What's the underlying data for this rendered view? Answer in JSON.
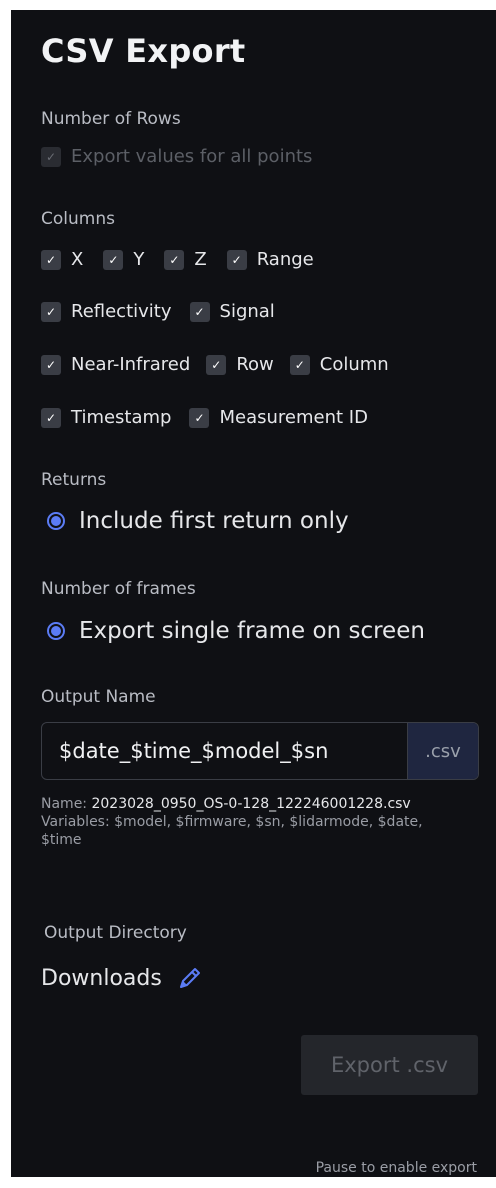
{
  "title": "CSV Export",
  "rows_section": {
    "label": "Number of Rows",
    "option_label": "Export values for all points",
    "checkmark": "✓"
  },
  "columns_section": {
    "label": "Columns",
    "checkmark": "✓",
    "rows": [
      [
        "X",
        "Y",
        "Z",
        "Range"
      ],
      [
        "Reflectivity",
        "Signal"
      ],
      [
        "Near-Infrared",
        "Row",
        "Column"
      ],
      [
        "Timestamp",
        "Measurement ID"
      ]
    ]
  },
  "returns_section": {
    "label": "Returns",
    "option_label": "Include first return only"
  },
  "frames_section": {
    "label": "Number of frames",
    "option_label": "Export single frame on screen"
  },
  "output_name": {
    "label": "Output Name",
    "value": "$date_$time_$model_$sn",
    "suffix": ".csv",
    "name_prefix": "Name: ",
    "name_value": "2023028_0950_OS-0-128_122246001228.csv",
    "variables_text": "Variables: $model, $firmware, $sn, $lidarmode, $date, $time"
  },
  "output_directory": {
    "label": "Output Directory",
    "value": "Downloads",
    "edit_icon": "pencil-icon"
  },
  "export_button": {
    "label": "Export .csv"
  },
  "pause_note": "Pause to enable export",
  "colors": {
    "panel_bg": "#0f1014",
    "accent": "#5b7cf5",
    "checkbox_bg": "#3a3d45"
  }
}
